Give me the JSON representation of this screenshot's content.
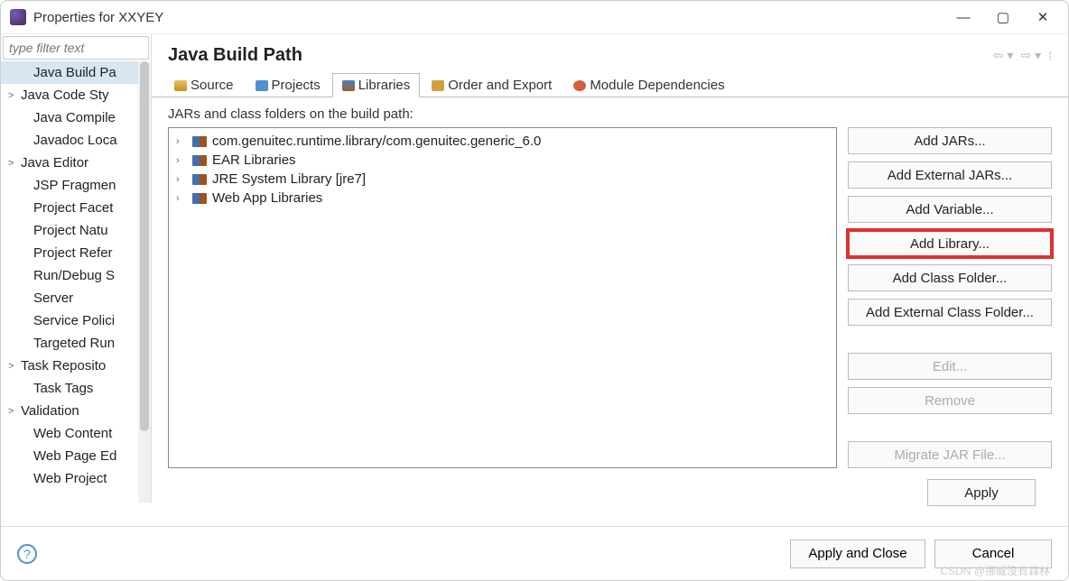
{
  "window": {
    "title": "Properties for XXYEY"
  },
  "filter": {
    "placeholder": "type filter text"
  },
  "tree": [
    {
      "label": "Java Build Pa",
      "selected": true,
      "expandable": false,
      "child": true
    },
    {
      "label": "Java Code Sty",
      "expandable": true
    },
    {
      "label": "Java Compile",
      "expandable": false,
      "child": true
    },
    {
      "label": "Javadoc Loca",
      "expandable": false,
      "child": true
    },
    {
      "label": "Java Editor",
      "expandable": true
    },
    {
      "label": "JSP Fragmen",
      "expandable": false,
      "child": true
    },
    {
      "label": "Project Facet",
      "expandable": false,
      "child": true
    },
    {
      "label": "Project Natu",
      "expandable": false,
      "child": true
    },
    {
      "label": "Project Refer",
      "expandable": false,
      "child": true
    },
    {
      "label": "Run/Debug S",
      "expandable": false,
      "child": true
    },
    {
      "label": "Server",
      "expandable": false,
      "child": true
    },
    {
      "label": "Service Polici",
      "expandable": false,
      "child": true
    },
    {
      "label": "Targeted Run",
      "expandable": false,
      "child": true
    },
    {
      "label": "Task Reposito",
      "expandable": true
    },
    {
      "label": "Task Tags",
      "expandable": false,
      "child": true
    },
    {
      "label": "Validation",
      "expandable": true
    },
    {
      "label": "Web Content",
      "expandable": false,
      "child": true
    },
    {
      "label": "Web Page Ed",
      "expandable": false,
      "child": true
    },
    {
      "label": "Web Project",
      "expandable": false,
      "child": true
    }
  ],
  "page": {
    "title": "Java Build Path"
  },
  "tabs": [
    {
      "label": "Source",
      "icon": "src"
    },
    {
      "label": "Projects",
      "icon": "prj"
    },
    {
      "label": "Libraries",
      "icon": "lib",
      "active": true
    },
    {
      "label": "Order and Export",
      "icon": "ord"
    },
    {
      "label": "Module Dependencies",
      "icon": "mod"
    }
  ],
  "libraries": {
    "subhead": "JARs and class folders on the build path:",
    "items": [
      {
        "label": "com.genuitec.runtime.library/com.genuitec.generic_6.0"
      },
      {
        "label": "EAR Libraries"
      },
      {
        "label": "JRE System Library [jre7]"
      },
      {
        "label": "Web App Libraries"
      }
    ]
  },
  "buttons": {
    "add_jars": "Add JARs...",
    "add_ext_jars": "Add External JARs...",
    "add_variable": "Add Variable...",
    "add_library": "Add Library...",
    "add_class_folder": "Add Class Folder...",
    "add_ext_class_folder": "Add External Class Folder...",
    "edit": "Edit...",
    "remove": "Remove",
    "migrate": "Migrate JAR File...",
    "apply": "Apply",
    "apply_close": "Apply and Close",
    "cancel": "Cancel"
  },
  "watermark": "CSDN @挪威沒有森林"
}
